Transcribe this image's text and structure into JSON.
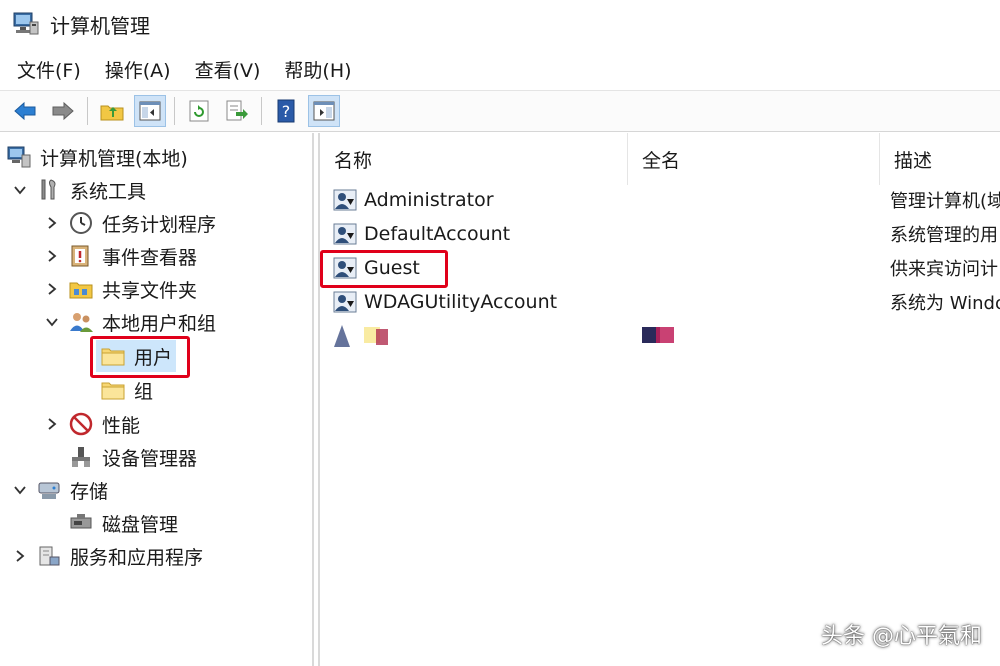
{
  "window": {
    "title": "计算机管理"
  },
  "menu": [
    {
      "label": "文件(F)"
    },
    {
      "label": "操作(A)"
    },
    {
      "label": "查看(V)"
    },
    {
      "label": "帮助(H)"
    }
  ],
  "toolbar": {
    "icons": [
      "back-arrow-icon",
      "forward-arrow-icon",
      "up-folder-icon",
      "show-hide-console-tree-icon",
      "refresh-icon",
      "export-list-icon",
      "help-icon",
      "show-hide-action-pane-icon"
    ]
  },
  "tree": {
    "root": "计算机管理(本地)",
    "system_tools": "系统工具",
    "task_scheduler": "任务计划程序",
    "event_viewer": "事件查看器",
    "shared_folders": "共享文件夹",
    "local_users_groups": "本地用户和组",
    "users": "用户",
    "groups": "组",
    "performance": "性能",
    "device_manager": "设备管理器",
    "storage": "存储",
    "disk_management": "磁盘管理",
    "services_apps": "服务和应用程序"
  },
  "list": {
    "columns": [
      "名称",
      "全名",
      "描述"
    ],
    "rows": [
      {
        "name": "Administrator",
        "fullname": "",
        "desc": "管理计算机(域"
      },
      {
        "name": "DefaultAccount",
        "fullname": "",
        "desc": "系统管理的用"
      },
      {
        "name": "Guest",
        "fullname": "",
        "desc": "供来宾访问计"
      },
      {
        "name": "WDAGUtilityAccount",
        "fullname": "",
        "desc": "系统为 Windo"
      }
    ]
  },
  "watermark": "头条 @心平氣和",
  "colors": {
    "highlight": "#e0001a",
    "selection": "#cde6fb"
  }
}
